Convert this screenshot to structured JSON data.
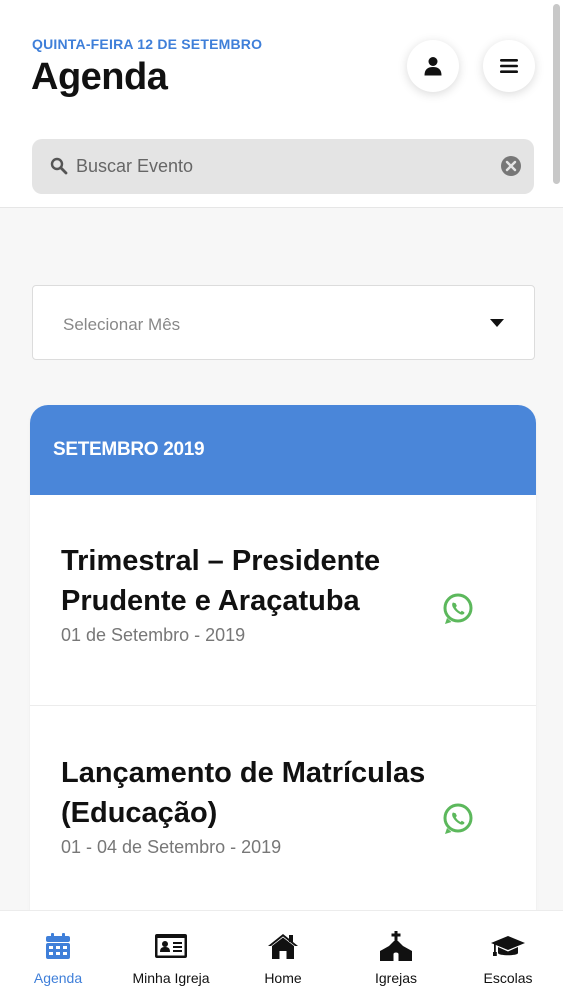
{
  "header": {
    "date": "QUINTA-FEIRA 12 DE SETEMBRO",
    "title": "Agenda"
  },
  "search": {
    "placeholder": "Buscar Evento",
    "value": ""
  },
  "month_select": {
    "placeholder": "Selecionar Mês"
  },
  "agenda": {
    "month_header": "SETEMBRO 2019",
    "events": [
      {
        "title": "Trimestral – Presidente Prudente e Araçatuba",
        "date": "01 de Setembro - 2019"
      },
      {
        "title": "Lançamento de Matrículas (Educação)",
        "date": "01 - 04 de Setembro - 2019"
      }
    ]
  },
  "nav": {
    "items": [
      {
        "label": "Agenda",
        "icon": "calendar-icon",
        "active": true
      },
      {
        "label": "Minha Igreja",
        "icon": "id-card-icon",
        "active": false
      },
      {
        "label": "Home",
        "icon": "home-icon",
        "active": false
      },
      {
        "label": "Igrejas",
        "icon": "church-icon",
        "active": false
      },
      {
        "label": "Escolas",
        "icon": "graduation-cap-icon",
        "active": false
      }
    ]
  },
  "colors": {
    "accent": "#4a86d9",
    "accent_text": "#3f7fd9",
    "whatsapp": "#5cb85c"
  }
}
